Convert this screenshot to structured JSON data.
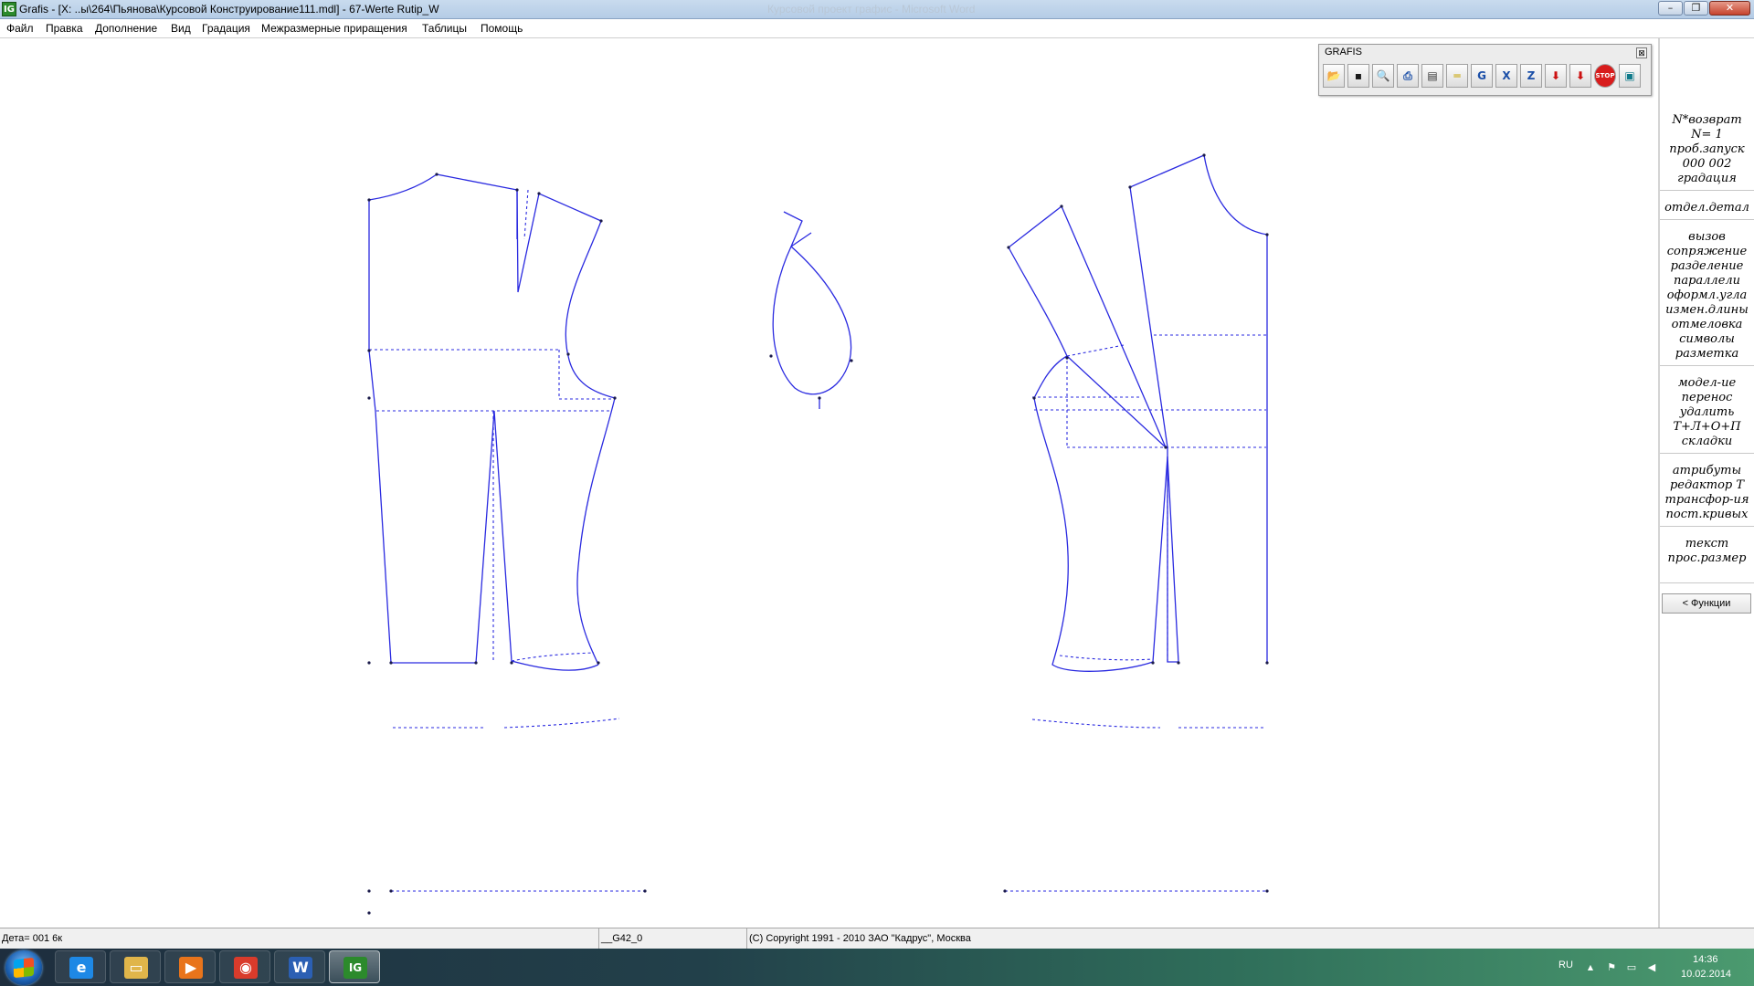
{
  "window": {
    "title": "Grafis - [X: ..ы\\264\\Пьянова\\Курсовой Конструирование111.mdl] - 67-Werte Rutip_W",
    "ghost_title": "Курсовой проект графис - Microsoft Word",
    "app_icon": "IG",
    "minimize_glyph": "–",
    "restore_glyph": "❐",
    "close_glyph": "✕"
  },
  "menubar": {
    "items": [
      "Файл",
      "Правка",
      "Дополнение",
      "Вид",
      "Градация",
      "Межразмерные приращения",
      "Таблицы",
      "Помощь"
    ]
  },
  "grafis_toolbar": {
    "title": "GRAFIS",
    "close_glyph": "⊠",
    "buttons": [
      {
        "name": "open-folder-icon",
        "glyph": "📂",
        "color": "#c58a1a"
      },
      {
        "name": "save-disk-icon",
        "glyph": "▪",
        "color": "#1a1a1a"
      },
      {
        "name": "zoom-magnifier-icon",
        "glyph": "🔍",
        "color": "#1b4fa8"
      },
      {
        "name": "print-icon",
        "glyph": "⎙",
        "color": "#1b4fa8"
      },
      {
        "name": "page-layout-icon",
        "glyph": "▤",
        "color": "#333333"
      },
      {
        "name": "ruler-measure-icon",
        "glyph": "═",
        "color": "#c8a400"
      },
      {
        "name": "grafis-g-icon",
        "glyph": "G",
        "color": "#1b4fa8"
      },
      {
        "name": "delete-x-icon",
        "glyph": "X",
        "color": "#1b4fa8"
      },
      {
        "name": "z-function-icon",
        "glyph": "Z",
        "color": "#1b4fa8"
      },
      {
        "name": "download-arrow-icon",
        "glyph": "⬇",
        "color": "#cc1010"
      },
      {
        "name": "import-arrow-icon",
        "glyph": "⬇",
        "color": "#cc1010"
      },
      {
        "name": "stop-sign-icon",
        "glyph": "STOP",
        "color": "#d81c1c"
      },
      {
        "name": "monitor-screen-icon",
        "glyph": "▣",
        "color": "#0f7a8a"
      }
    ]
  },
  "function_panel": {
    "group1": [
      "N*возврат",
      "N=  1",
      "проб.запуск",
      "000 002",
      "градация"
    ],
    "group2": [
      "отдел.детал"
    ],
    "group3": [
      "вызов",
      "сопряжение",
      "разделение",
      "параллели",
      "оформл.угла",
      "измен.длины",
      "отмеловка",
      "символы",
      "разметка"
    ],
    "group4": [
      "модел-ие",
      "перенос",
      "удалить",
      "Т+Л+О+П",
      "складки"
    ],
    "group5": [
      "атрибуты",
      "редактор Т",
      "трансфор-ия",
      "пост.кривых"
    ],
    "group6": [
      "текст",
      "прос.размер"
    ],
    "functions_button": "< Функции"
  },
  "statusbar": {
    "detail": "Дета= 001  6к",
    "layer": "__G42_0",
    "copyright": "(C) Copyright 1991 - 2010 ЗАО \"Кадрус\", Москва"
  },
  "taskbar": {
    "apps": [
      {
        "name": "internet-explorer-icon",
        "glyph": "e",
        "color": "#1e88e5"
      },
      {
        "name": "file-explorer-icon",
        "glyph": "▭",
        "color": "#e0b54a"
      },
      {
        "name": "media-player-icon",
        "glyph": "▶",
        "color": "#e8741b"
      },
      {
        "name": "chrome-icon",
        "glyph": "◉",
        "color": "#d93b2b"
      },
      {
        "name": "word-icon",
        "glyph": "W",
        "color": "#2b5fb3"
      },
      {
        "name": "grafis-app-icon",
        "glyph": "IG",
        "color": "#2c8a2c"
      }
    ],
    "lang": "RU",
    "tray_up": "▲",
    "tray_flag": "⚑",
    "tray_network": "▭",
    "tray_volume": "◀",
    "time": "14:36",
    "date": "10.02.2014"
  }
}
